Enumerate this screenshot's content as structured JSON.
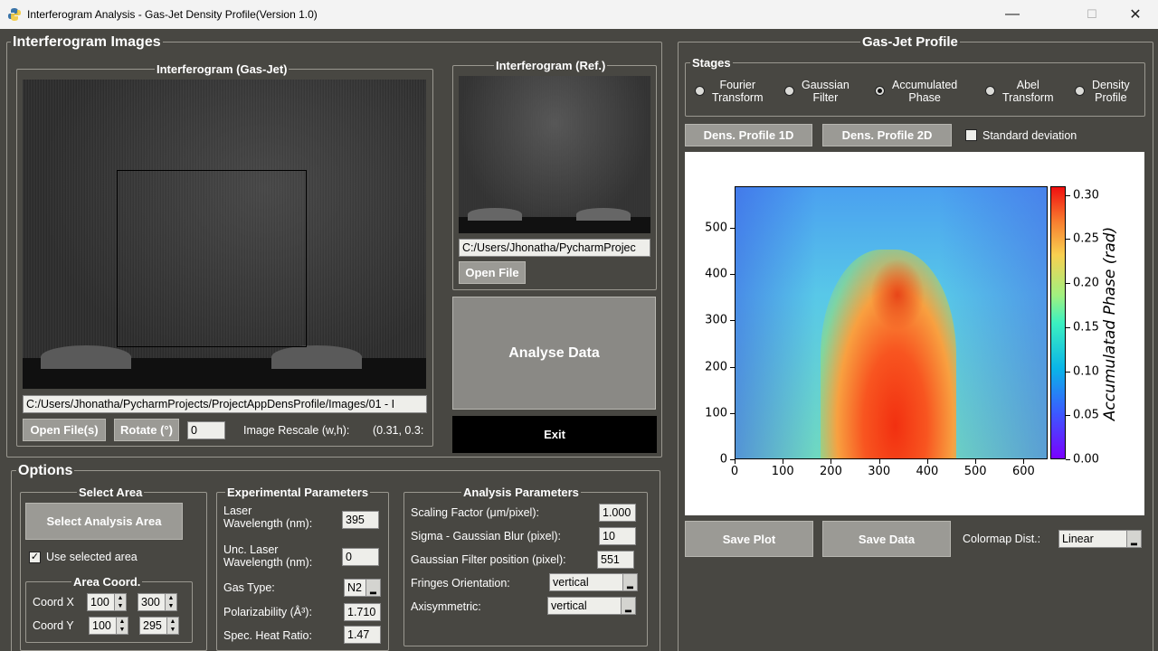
{
  "window": {
    "title": "Interferogram Analysis - Gas-Jet Density Profile(Version 1.0)",
    "minimize": "—",
    "maximize": "☐",
    "close": "✕"
  },
  "images_panel": {
    "title": "Interferogram Images",
    "gasjet_title": "Interferogram (Gas-Jet)",
    "ref_title": "Interferogram (Ref.)",
    "gasjet_path": "C:/Users/Jhonatha/PycharmProjects/ProjectAppDensProfile/Images/01 - I",
    "ref_path": "C:/Users/Jhonatha/PycharmProjec",
    "open_files_label": "Open File(s)",
    "rotate_label": "Rotate (°)",
    "rotate_value": "0",
    "rescale_label": "Image Rescale (w,h):",
    "rescale_value": "(0.31, 0.3:",
    "open_file_label": "Open File",
    "analyse_label": "Analyse Data",
    "exit_label": "Exit"
  },
  "options": {
    "title": "Options",
    "select_area": {
      "title": "Select Area",
      "button": "Select Analysis Area",
      "use_selected": "Use selected area",
      "coord_title": "Area Coord.",
      "x_label": "Coord X",
      "y_label": "Coord Y",
      "x1": "100",
      "x2": "300",
      "y1": "100",
      "y2": "295"
    },
    "experimental": {
      "title": "Experimental Parameters",
      "laser_label": "Laser\nWavelength (nm):",
      "laser_value": "395",
      "unc_label": "Unc. Laser\nWavelength (nm):",
      "unc_value": "0",
      "gas_label": "Gas Type:",
      "gas_value": "N2",
      "polar_label": "Polarizability (Å³):",
      "polar_value": "1.710",
      "heat_label": "Spec. Heat Ratio:",
      "heat_value": "1.47"
    },
    "analysis": {
      "title": "Analysis Parameters",
      "scaling_label": "Scaling Factor (μm/pixel):",
      "scaling_value": "1.000",
      "sigma_label": "Sigma - Gaussian Blur (pixel):",
      "sigma_value": "10",
      "gfpos_label": "Gaussian Filter position (pixel):",
      "gfpos_value": "551",
      "fringes_label": "Fringes Orientation:",
      "fringes_value": "vertical",
      "axisym_label": "Axisymmetric:",
      "axisym_value": "vertical"
    }
  },
  "profile_panel": {
    "title": "Gas-Jet Profile",
    "stages_title": "Stages",
    "stages": [
      {
        "label": "Fourier\nTransform",
        "selected": false
      },
      {
        "label": "Gaussian\nFilter",
        "selected": false
      },
      {
        "label": "Accumulated\nPhase",
        "selected": true
      },
      {
        "label": "Abel\nTransform",
        "selected": false
      },
      {
        "label": "Density\nProfile",
        "selected": false
      }
    ],
    "dens1d_label": "Dens. Profile 1D",
    "dens2d_label": "Dens. Profile 2D",
    "stddev_label": "Standard deviation",
    "save_plot_label": "Save Plot",
    "save_data_label": "Save Data",
    "colormap_label": "Colormap Dist.:",
    "colormap_value": "Linear"
  },
  "chart_data": {
    "type": "heatmap",
    "title": "",
    "xlabel": "",
    "ylabel": "",
    "xlim": [
      0,
      650
    ],
    "ylim": [
      0,
      590
    ],
    "xticks": [
      "0",
      "100",
      "200",
      "300",
      "400",
      "500",
      "600"
    ],
    "yticks": [
      "0",
      "100",
      "200",
      "300",
      "400",
      "500"
    ],
    "colorbar": {
      "label": "Accumulatad Phase  (rad)",
      "range": [
        0.0,
        0.31
      ],
      "ticks": [
        "0.00",
        "0.05",
        "0.10",
        "0.15",
        "0.20",
        "0.25",
        "0.30"
      ],
      "colormap": "rainbow"
    },
    "description_peak_x": 330,
    "peak_value": 0.31
  },
  "colors": {
    "background": "#484742",
    "button": "#9b9a95",
    "exit_button": "#000000",
    "analyse_button": "#8a8985"
  }
}
